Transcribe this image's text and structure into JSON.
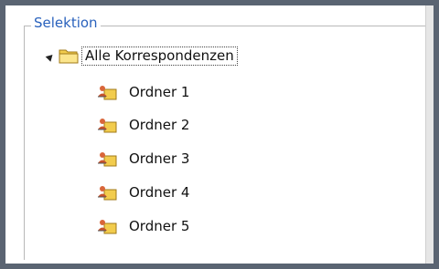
{
  "groupbox": {
    "title": "Selektion"
  },
  "tree": {
    "root": {
      "label": "Alle Korrespondenzen",
      "icon": "folder-icon",
      "expanded": true
    },
    "children": [
      {
        "label": "Ordner 1",
        "icon": "user-folder-icon"
      },
      {
        "label": "Ordner 2",
        "icon": "user-folder-icon"
      },
      {
        "label": "Ordner 3",
        "icon": "user-folder-icon"
      },
      {
        "label": "Ordner 4",
        "icon": "user-folder-icon"
      },
      {
        "label": "Ordner 5",
        "icon": "user-folder-icon"
      }
    ]
  },
  "colors": {
    "title": "#2a62bd",
    "frame": "#5a6472",
    "folder": "#f2cc4d"
  }
}
